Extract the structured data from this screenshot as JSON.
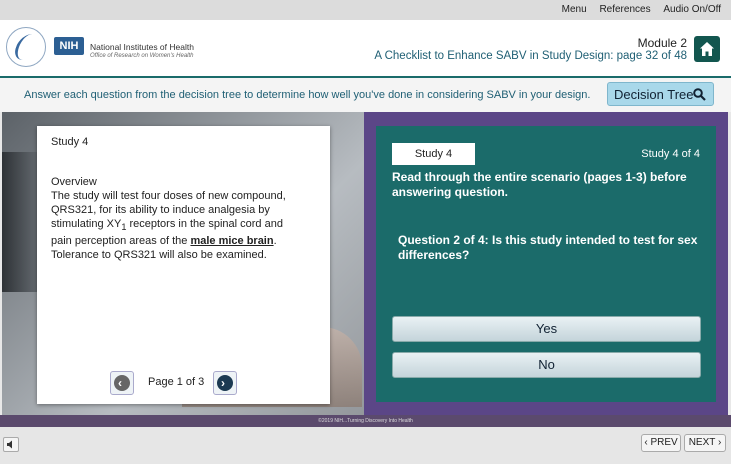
{
  "topbar": {
    "menu": "Menu",
    "references": "References",
    "audio": "Audio On/Off"
  },
  "header": {
    "org_badge": "NIH",
    "org_name": "National Institutes of Health",
    "org_sub": "Office of Research on Women's Health",
    "module": "Module 2",
    "subtitle": "A Checklist to Enhance SABV in Study Design: page 32 of 48"
  },
  "instruction": {
    "text": "Answer each question from the decision tree to determine how well you've done in considering SABV in your design.",
    "button": "Decision Tree"
  },
  "card": {
    "study_title": "Study 4",
    "overview_heading": "Overview",
    "body_before": "The study will test four doses of new compound, QRS321, for its ability to induce analgesia by stimulating XY",
    "body_sub": "1",
    "body_mid": " receptors in the spinal cord and pain perception areas of the ",
    "body_emph": "male mice brain",
    "body_after": ". Tolerance to QRS321 will also be examined.",
    "page_label": "Page 1 of 3"
  },
  "panel": {
    "tab": "Study 4",
    "counter": "Study 4 of 4",
    "lead": "Read through the entire scenario (pages 1-3) before answering question.",
    "question": "Question 2 of 4: Is this study intended to test for sex differences?",
    "yes": "Yes",
    "no": "No"
  },
  "footer": {
    "copyright": "©2019 NIH...Turning Discovery Into Health",
    "prev": "PREV",
    "next": "NEXT"
  },
  "colors": {
    "teal": "#1b6b6a",
    "purple": "#5b4687",
    "button_blue": "#a9d8ea"
  },
  "icons": [
    "home-icon",
    "search-icon",
    "speaker-icon",
    "chevron-left-icon",
    "chevron-right-icon"
  ]
}
